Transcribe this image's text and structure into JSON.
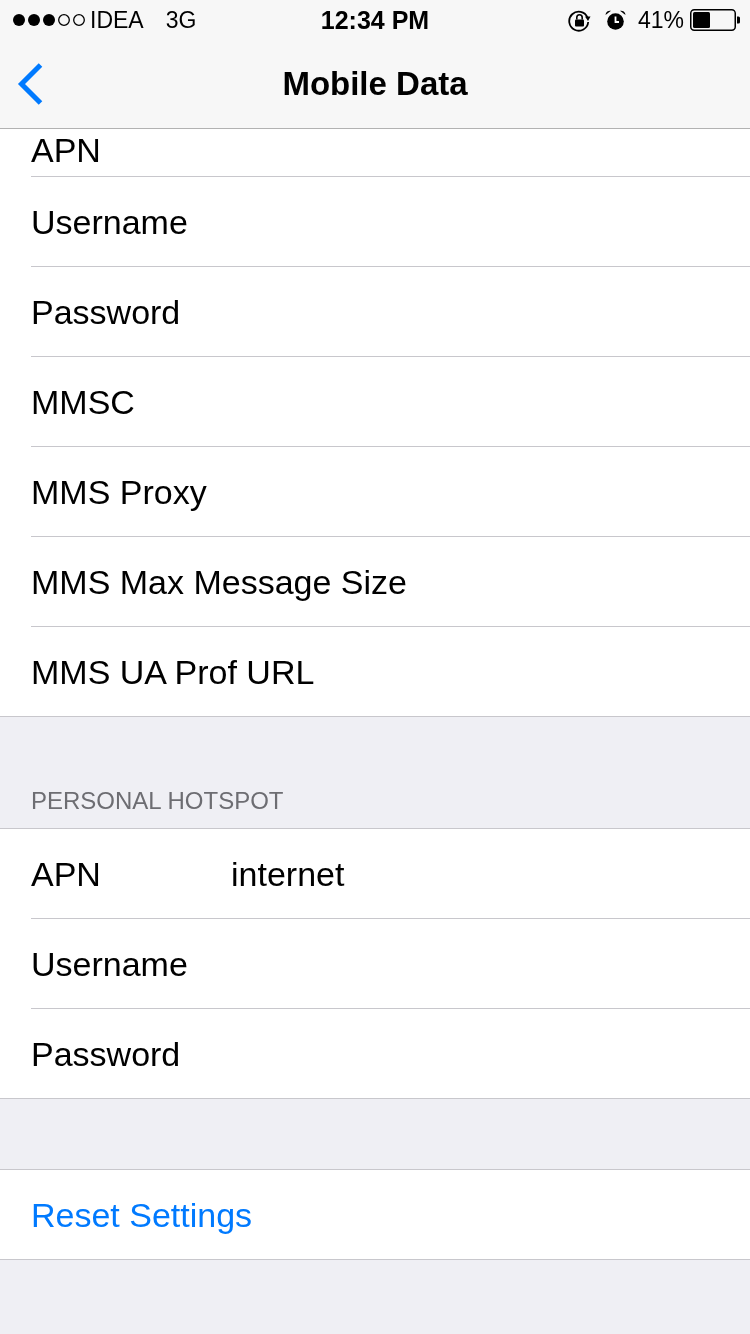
{
  "status_bar": {
    "carrier": "IDEA",
    "network": "3G",
    "time": "12:34 PM",
    "battery": "41%"
  },
  "nav_bar": {
    "title": "Mobile Data"
  },
  "sections": [
    {
      "rows": [
        {
          "kind": "field",
          "label": "APN"
        },
        {
          "kind": "field",
          "label": "Username"
        },
        {
          "kind": "field",
          "label": "Password"
        },
        {
          "kind": "field",
          "label": "MMSC"
        },
        {
          "kind": "field",
          "label": "MMS Proxy"
        },
        {
          "kind": "field",
          "label": "MMS Max Message Size"
        },
        {
          "kind": "field",
          "label": "MMS UA Prof URL"
        }
      ]
    },
    {
      "header": "PERSONAL HOTSPOT",
      "rows": [
        {
          "kind": "field",
          "label": "APN",
          "value": "internet"
        },
        {
          "kind": "field",
          "label": "Username"
        },
        {
          "kind": "field",
          "label": "Password"
        }
      ]
    },
    {
      "rows": [
        {
          "kind": "action",
          "label": "Reset Settings"
        }
      ]
    }
  ]
}
